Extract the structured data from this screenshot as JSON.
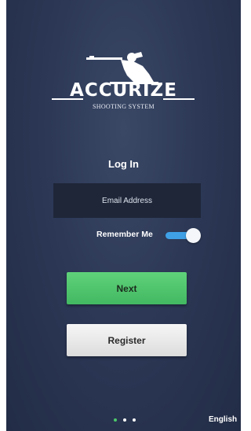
{
  "brand": {
    "name": "ACCURIZE",
    "tagline": "SHOOTING SYSTEM"
  },
  "login": {
    "title": "Log In",
    "email_placeholder": "Email Address",
    "email_value": "",
    "remember_label": "Remember Me",
    "remember_on": true
  },
  "buttons": {
    "next": "Next",
    "register": "Register"
  },
  "pager": {
    "count": 3,
    "active_index": 0
  },
  "footer": {
    "language": "English"
  },
  "colors": {
    "background": "#2c3856",
    "next_button": "#4cc46b",
    "register_button": "#e8e8e8",
    "toggle_on": "#3fa0e6",
    "active_dot": "#4cc96a"
  },
  "icons": {
    "logo": "shooter-silhouette-icon"
  }
}
